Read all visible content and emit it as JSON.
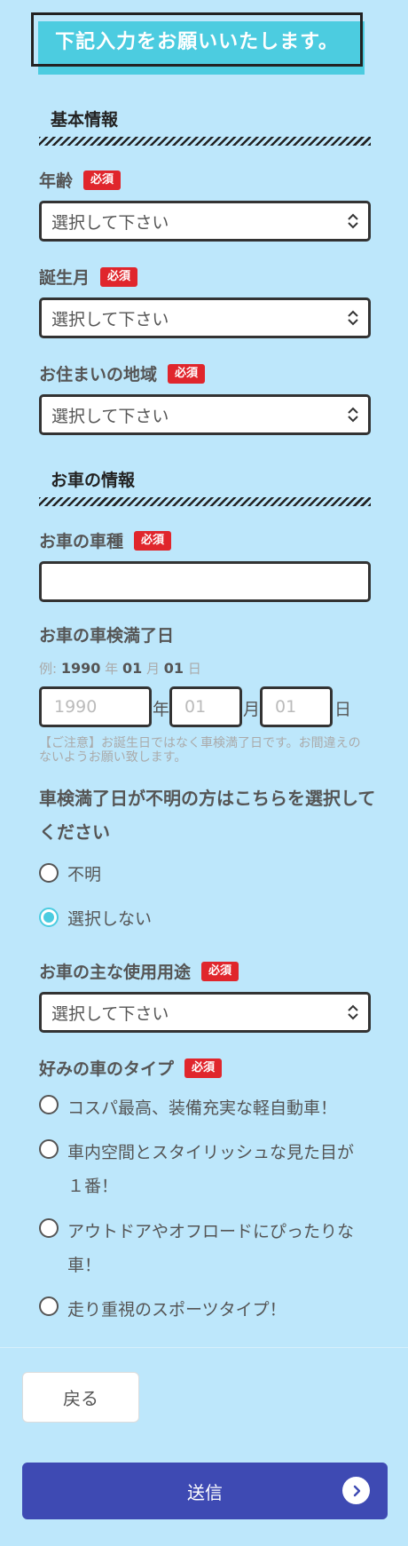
{
  "banner": {
    "text": "下記入力をお願いいたします。"
  },
  "sections": {
    "basic": "基本情報",
    "car": "お車の情報"
  },
  "required_badge": "必須",
  "fields": {
    "age": {
      "label": "年齢",
      "value": "選択して下さい"
    },
    "birth_month": {
      "label": "誕生月",
      "value": "選択して下さい"
    },
    "region": {
      "label": "お住まいの地域",
      "value": "選択して下さい"
    },
    "car_model": {
      "label": "お車の車種",
      "value": ""
    },
    "inspection_date": {
      "label": "お車の車検満了日",
      "example_prefix": "例:",
      "example_year": "1990",
      "example_year_unit": "年",
      "example_month": "01",
      "example_month_unit": "月",
      "example_day": "01",
      "example_day_unit": "日",
      "year_placeholder": "1990",
      "month_placeholder": "01",
      "day_placeholder": "01",
      "year_unit": "年",
      "month_unit": "月",
      "day_unit": "日",
      "note": "【ご注意】お誕生日ではなく車検満了日です。お間違えのないようお願い致します。"
    },
    "unknown_date": {
      "label": "車検満了日が不明の方はこちらを選択してください",
      "options": [
        {
          "label": "不明",
          "selected": false
        },
        {
          "label": "選択しない",
          "selected": true
        }
      ]
    },
    "usage": {
      "label": "お車の主な使用用途",
      "value": "選択して下さい"
    },
    "car_type": {
      "label": "好みの車のタイプ",
      "options": [
        {
          "label": "コスパ最高、装備充実な軽自動車！",
          "selected": false
        },
        {
          "label": "車内空間とスタイリッシュな見た目が１番！",
          "selected": false
        },
        {
          "label": "アウトドアやオフロードにぴったりな車！",
          "selected": false
        },
        {
          "label": "走り重視のスポーツタイプ！",
          "selected": false
        }
      ]
    }
  },
  "buttons": {
    "back": "戻る",
    "send": "送信"
  }
}
